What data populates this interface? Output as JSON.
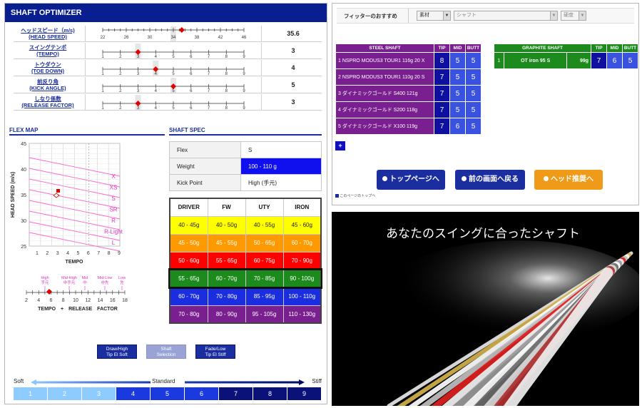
{
  "left": {
    "title": "SHAFT OPTIMIZER",
    "rows": [
      {
        "label_jp": "ヘッドスピード（m/s)",
        "label_en": "(HEAD SPEED)",
        "ticks": [
          "22",
          "26",
          "30",
          "34",
          "38",
          "42",
          "46"
        ],
        "value": "35.6"
      },
      {
        "label_jp": "スイングテンポ",
        "label_en": "(TEMPO)",
        "ticks": [
          "1",
          "2",
          "3",
          "4",
          "5",
          "6",
          "7",
          "8",
          "9"
        ],
        "value": "3"
      },
      {
        "label_jp": "トウダウン",
        "label_en": "(TOE DOWN)",
        "ticks": [
          "1",
          "2",
          "3",
          "4",
          "5",
          "6",
          "7",
          "8",
          "9"
        ],
        "value": "4"
      },
      {
        "label_jp": "前反り角",
        "label_en": "(KICK ANGLE)",
        "ticks": [
          "1",
          "2",
          "3",
          "4",
          "5",
          "6",
          "7",
          "8",
          "9"
        ],
        "value": "5"
      },
      {
        "label_jp": "しなり係数",
        "label_en": "(RELEASE FACTOR)",
        "ticks": [
          "1",
          "2",
          "3",
          "4",
          "5",
          "6",
          "7",
          "8",
          "9"
        ],
        "value": "3"
      }
    ],
    "flex_map": {
      "heading": "FLEX MAP",
      "ylabel": "HEAD SPEED (m/s)",
      "xlabel": "TEMPO",
      "y_ticks": [
        "45",
        "40",
        "35",
        "30",
        "25"
      ],
      "x_ticks": [
        "1",
        "2",
        "3",
        "4",
        "5",
        "6",
        "7",
        "8",
        "9"
      ],
      "flex_labels": [
        "X",
        "XS",
        "S",
        "SR",
        "R",
        "R-Light",
        "L"
      ],
      "tempo_scale": {
        "top_labels": [
          {
            "jp": "High",
            "sub": "手元"
          },
          {
            "jp": "Mid-High",
            "sub": "中手元"
          },
          {
            "jp": "Mid",
            "sub": "中"
          },
          {
            "jp": "Mid-Low",
            "sub": "中先"
          },
          {
            "jp": "Low",
            "sub": "先"
          }
        ],
        "ticks": [
          "2",
          "4",
          "6",
          "8",
          "10",
          "12",
          "14",
          "16",
          "18"
        ],
        "caption": "TEMPO　+　RELEASE　FACTOR"
      }
    },
    "shaft_spec": {
      "heading": "SHAFT SPEC",
      "rows": [
        {
          "k": "Flex",
          "v": "S"
        },
        {
          "k": "Weight",
          "v": "100 - 110 g"
        },
        {
          "k": "Kick Point",
          "v": "High (手元)"
        }
      ]
    },
    "weight_table": {
      "headers": [
        "DRIVER",
        "FW",
        "UTY",
        "IRON"
      ],
      "rows": [
        {
          "cells": [
            "40 - 45g",
            "40 - 50g",
            "40 - 55g",
            "45 - 60g"
          ],
          "bg": "#ffff00",
          "fg": "#222222"
        },
        {
          "cells": [
            "45 - 50g",
            "45 - 55g",
            "50 - 65g",
            "60 - 70g"
          ],
          "bg": "#ff9900",
          "fg": "#ffffff"
        },
        {
          "cells": [
            "50 - 60g",
            "55 - 65g",
            "60 - 75g",
            "70 - 90g"
          ],
          "bg": "#ff0000",
          "fg": "#ffffff"
        },
        {
          "cells": [
            "55 - 65g",
            "60 - 70g",
            "70 - 85g",
            "90 - 100g"
          ],
          "bg": "#1c8a1c",
          "fg": "#ffffff"
        },
        {
          "cells": [
            "60 - 70g",
            "70 - 80g",
            "85 - 95g",
            "100 - 110g"
          ],
          "bg": "#1a2ee0",
          "fg": "#ffffff"
        },
        {
          "cells": [
            "70 - 80g",
            "80 - 90g",
            "95 - 105g",
            "110 - 130g"
          ],
          "bg": "#7a1f8f",
          "fg": "#ffffff"
        }
      ]
    },
    "nav_buttons": [
      {
        "l1": "Draw/High",
        "l2": "Tip El Soft"
      },
      {
        "l1": "Shaft",
        "l2": "Selection"
      },
      {
        "l1": "Fade/Low",
        "l2": "Tip El Stiff"
      }
    ],
    "stiffness": {
      "soft": "Soft",
      "standard": "Standard",
      "stiff": "Stiff",
      "cells": [
        "1",
        "2",
        "3",
        "4",
        "5",
        "6",
        "7",
        "8",
        "9"
      ]
    }
  },
  "right_top": {
    "fitter_label": "フィッターのおすすめ",
    "selects": {
      "material": "素材",
      "shaft": "シャフト",
      "hardness": "硬度"
    },
    "steel": {
      "header": "STEEL SHAFT",
      "tip": "TIP",
      "mid": "MID",
      "butt": "BUTT",
      "rows": [
        {
          "name": "1  NSPRO MODUS3 TOUR1 116g 20 X",
          "tip": "8",
          "mid": "5",
          "butt": "5"
        },
        {
          "name": "2  NSPRO MODUS3 TOUR1 110g 20 S",
          "tip": "7",
          "mid": "5",
          "butt": "5"
        },
        {
          "name": "3  ダイナミックゴールド S400  121g",
          "tip": "7",
          "mid": "5",
          "butt": "5"
        },
        {
          "name": "4  ダイナミックゴールド S200  118g",
          "tip": "7",
          "mid": "5",
          "butt": "5"
        },
        {
          "name": "5  ダイナミックゴールド X100  119g",
          "tip": "7",
          "mid": "6",
          "butt": "5"
        }
      ]
    },
    "graphite": {
      "header": "GRAPHITE SHAFT",
      "tip": "TIP",
      "mid": "MID",
      "butt": "BUTT",
      "rows": [
        {
          "no": "1",
          "name": "OT iron 95 S",
          "weight": "99g",
          "tip": "7",
          "mid": "6",
          "butt": "5"
        }
      ]
    },
    "add_symbol": "+",
    "buttons": {
      "top": "トップページへ",
      "back": "前の画面へ戻る",
      "head": "ヘッド推奨へ"
    },
    "footnote": "このページのトップへ"
  },
  "right_bottom": {
    "headline": "あなたのスイングに合ったシャフト"
  }
}
